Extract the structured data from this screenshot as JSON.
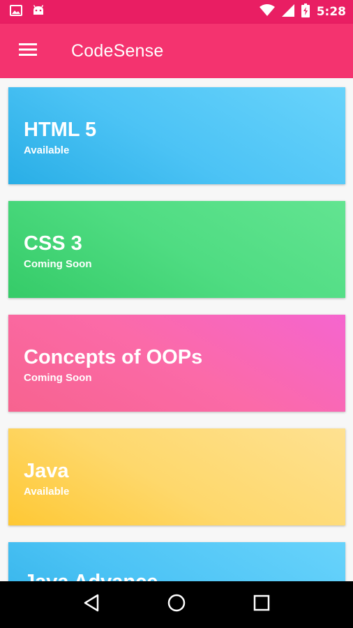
{
  "status_bar": {
    "time": "5:28",
    "icons": [
      "image-icon",
      "android-icon",
      "wifi-icon",
      "signal-icon",
      "battery-charging-icon"
    ]
  },
  "app_bar": {
    "title": "CodeSense",
    "menu_icon": "hamburger-menu-icon",
    "color": "#f4336f"
  },
  "topics": [
    {
      "title": "HTML 5",
      "status": "Available",
      "color": "#4cc3f5"
    },
    {
      "title": "CSS 3",
      "status": "Coming Soon",
      "color": "#4fdc82"
    },
    {
      "title": "Concepts of OOPs",
      "status": "Coming Soon",
      "color": "#fb6aa8"
    },
    {
      "title": "Java",
      "status": "Available",
      "color": "#fed86c"
    },
    {
      "title": "Java Advance",
      "color": "#4cc3f5"
    }
  ],
  "nav_bar": {
    "icons": [
      "back-icon",
      "home-icon",
      "recents-icon"
    ]
  }
}
